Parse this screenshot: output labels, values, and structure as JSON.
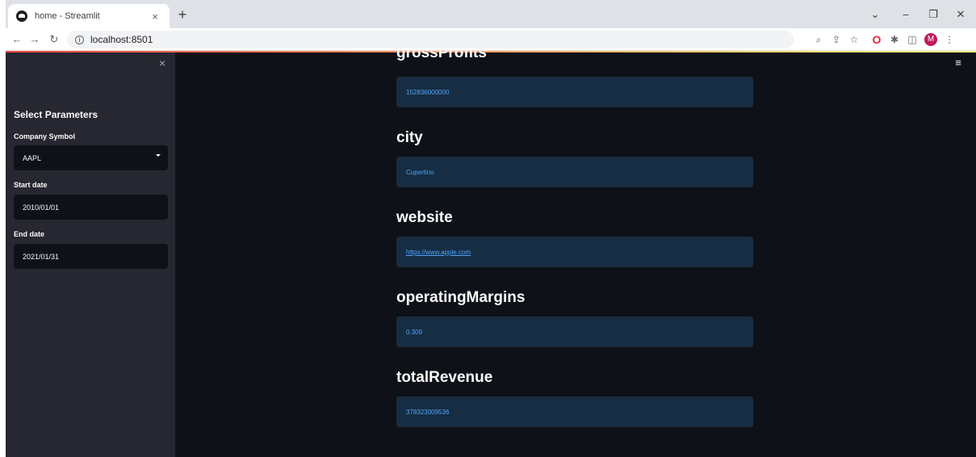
{
  "browser": {
    "tab_title": "home - Streamlit",
    "tab_close": "×",
    "new_tab": "+",
    "url": "localhost:8501",
    "profile_initial": "M",
    "window_controls": {
      "menu": "⌄",
      "minimize": "–",
      "restore": "❐",
      "close": "✕"
    }
  },
  "sidebar": {
    "close_glyph": "×",
    "title": "Select Parameters",
    "company_symbol": {
      "label": "Company Symbol",
      "value": "AAPL"
    },
    "start_date": {
      "label": "Start date",
      "value": "2010/01/01"
    },
    "end_date": {
      "label": "End date",
      "value": "2021/01/31"
    }
  },
  "main": {
    "menu_glyph": "≡",
    "sections": [
      {
        "heading": "grossProfits",
        "value": "152836000000"
      },
      {
        "heading": "city",
        "value": "Cupertino"
      },
      {
        "heading": "website",
        "value": "https://www.apple.com"
      },
      {
        "heading": "operatingMargins",
        "value": "0.309"
      },
      {
        "heading": "totalRevenue",
        "value": "378323009536"
      }
    ]
  },
  "colors": {
    "page_bg": "#0e1117",
    "sidebar_bg": "#262730",
    "value_box_bg": "#172d43",
    "value_text": "#4ea6ff",
    "accent": "#ff4b4b"
  }
}
